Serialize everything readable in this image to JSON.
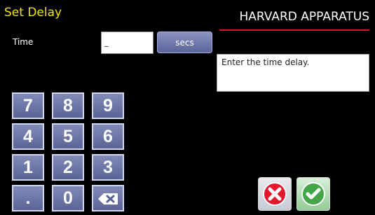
{
  "screen": {
    "title": "Set Delay",
    "brand": "HARVARD APPARATUS"
  },
  "time": {
    "label": "Time",
    "value": "_",
    "unit_label": "secs"
  },
  "help": {
    "text": "Enter the time delay."
  },
  "keypad": {
    "keys": {
      "seven": "7",
      "eight": "8",
      "nine": "9",
      "four": "4",
      "five": "5",
      "six": "6",
      "one": "1",
      "two": "2",
      "three": "3",
      "dot": ".",
      "zero": "0"
    },
    "backspace_icon": "backspace-icon"
  },
  "actions": {
    "cancel_icon": "cancel-icon",
    "confirm_icon": "confirm-icon"
  },
  "colors": {
    "background": "#000000",
    "title": "#F2E600",
    "brand_rule": "#D7192D",
    "key_fill": "#6E78AD",
    "key_border": "#D3D8F1",
    "cancel": "#E2162C",
    "confirm": "#44A648"
  }
}
